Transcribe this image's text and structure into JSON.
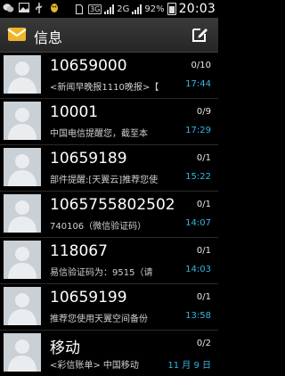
{
  "status_bar": {
    "network_1": "3G",
    "network_2": "2G",
    "battery_percent": "92%",
    "clock": "20:03",
    "icons": [
      "wechat-icon",
      "image-icon",
      "usb-icon",
      "qq-icon",
      "sim-icon",
      "signal-icon",
      "battery-icon"
    ]
  },
  "header": {
    "title": "信息",
    "app_icon": "envelope-icon",
    "compose_icon": "compose-icon"
  },
  "conversations": [
    {
      "name": "10659000",
      "preview": "<新闻早晚报1110晚报>【",
      "count": "0/10",
      "time": "17:44"
    },
    {
      "name": "10001",
      "preview": "中国电信提醒您，截至本",
      "count": "0/9",
      "time": "17:29"
    },
    {
      "name": "10659189",
      "preview": "部件提醒:[天翼云]推荐您使",
      "count": "0/1",
      "time": "15:22"
    },
    {
      "name": "1065755802502",
      "preview": "740106（微信验证码）",
      "count": "0/1",
      "time": "14:07"
    },
    {
      "name": "118067",
      "preview": "易信验证码为：9515（请",
      "count": "0/1",
      "time": "14:03"
    },
    {
      "name": "10659199",
      "preview": "推荐您使用天翼空间备份",
      "count": "0/1",
      "time": "13:58"
    },
    {
      "name": "移动",
      "preview": "<彩信账单> 中国移动",
      "count": "0/2",
      "time": "11 月 9 日"
    }
  ],
  "colors": {
    "accent": "#33b5e5",
    "avatar_bg": "#c9d0d6"
  }
}
